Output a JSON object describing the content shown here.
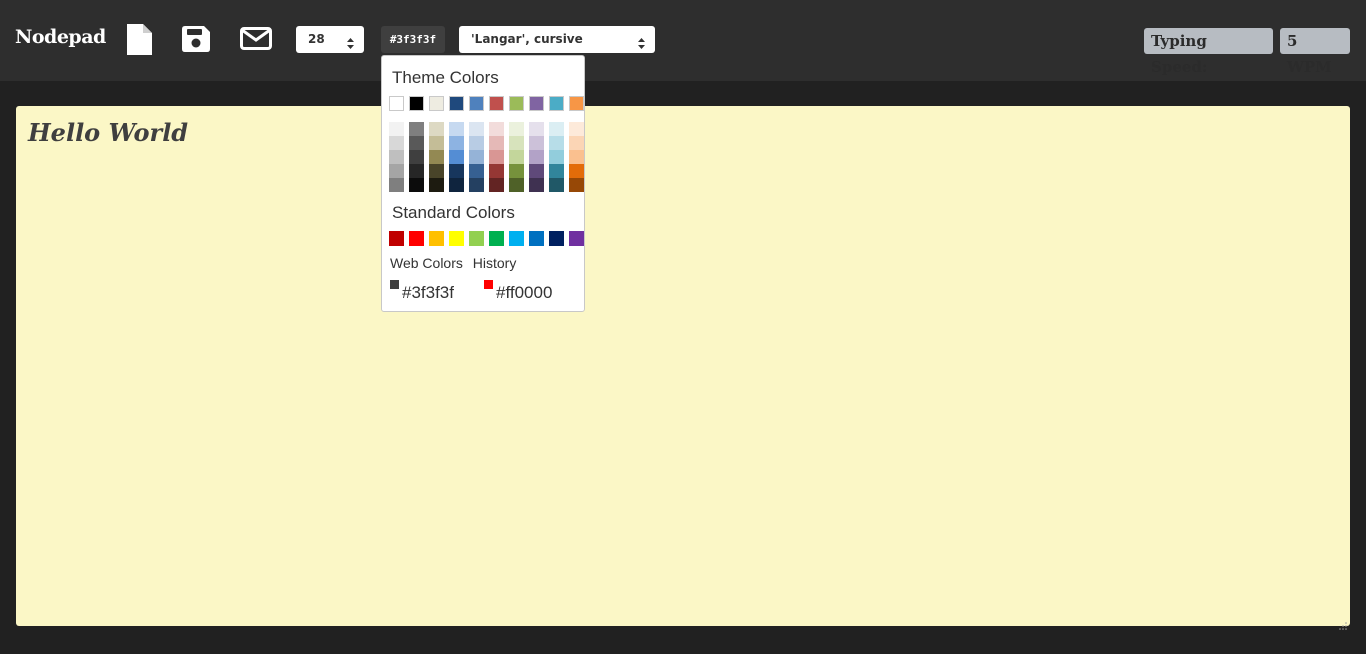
{
  "app": {
    "brand": "Nodepad"
  },
  "toolbar": {
    "icons": [
      "new-file-icon",
      "save-icon",
      "email-icon"
    ],
    "font_size": "28",
    "color_value": "#3f3f3f",
    "font_family": "'Langar', cursive"
  },
  "stats": {
    "label": "Typing Speed:",
    "value": "5 WPM"
  },
  "editor": {
    "content": "Hello World",
    "background": "#fbf7c6",
    "text_color": "#3f3f3f"
  },
  "color_picker": {
    "theme_title": "Theme Colors",
    "theme_colors": [
      "#ffffff",
      "#000000",
      "#eeece1",
      "#1f497d",
      "#4f81bd",
      "#c0504d",
      "#9bbb59",
      "#8064a2",
      "#4bacc6",
      "#f79646"
    ],
    "theme_shades": [
      [
        "#f2f2f2",
        "#d8d8d8",
        "#bfbfbf",
        "#a5a5a5",
        "#7f7f7f"
      ],
      [
        "#7f7f7f",
        "#595959",
        "#3f3f3f",
        "#262626",
        "#0c0c0c"
      ],
      [
        "#ddd9c3",
        "#c4bd97",
        "#938953",
        "#494429",
        "#1d1b10"
      ],
      [
        "#c6d9f0",
        "#8db3e2",
        "#548dd4",
        "#17365d",
        "#0f243e"
      ],
      [
        "#dbe5f1",
        "#b8cce4",
        "#95b3d7",
        "#366092",
        "#244061"
      ],
      [
        "#f2dcdb",
        "#e5b9b7",
        "#d99694",
        "#953734",
        "#632423"
      ],
      [
        "#ebf1dd",
        "#d7e3bc",
        "#c3d69b",
        "#76923c",
        "#4f6128"
      ],
      [
        "#e5e0ec",
        "#ccc1d9",
        "#b2a2c7",
        "#5f497a",
        "#3f3151"
      ],
      [
        "#dbeef3",
        "#b7dde8",
        "#92cddc",
        "#31859b",
        "#205867"
      ],
      [
        "#fdeada",
        "#fbd5b5",
        "#fac08f",
        "#e36c09",
        "#974806"
      ]
    ],
    "standard_title": "Standard Colors",
    "standard_colors": [
      "#c00000",
      "#ff0000",
      "#ffc000",
      "#ffff00",
      "#92d050",
      "#00b050",
      "#00b0f0",
      "#0070c0",
      "#002060",
      "#7030a0"
    ],
    "tabs": [
      "Web Colors",
      "History"
    ],
    "history": [
      {
        "hex": "#3f3f3f",
        "label": "#3f3f3f"
      },
      {
        "hex": "#ff0000",
        "label": "#ff0000"
      }
    ]
  }
}
